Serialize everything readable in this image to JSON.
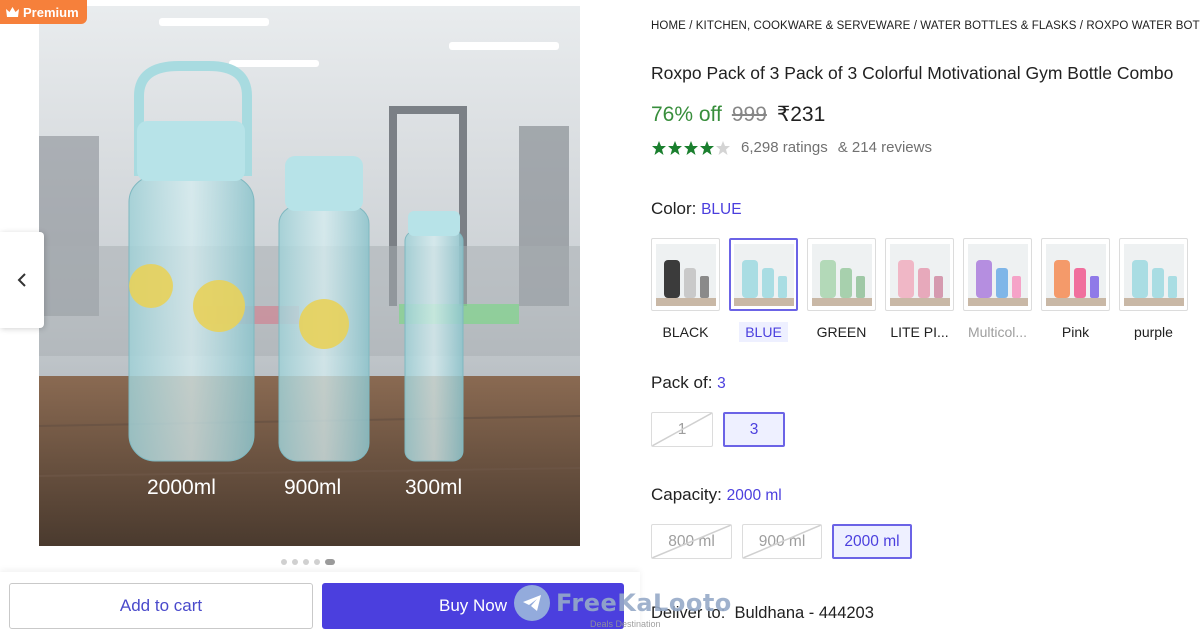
{
  "badge": {
    "label": "Premium"
  },
  "gallery": {
    "labels": [
      "2000ml",
      "900ml",
      "300ml"
    ],
    "dots_total": 5,
    "active_dot": 5
  },
  "actions": {
    "add_to_cart": "Add to cart",
    "buy_now": "Buy Now"
  },
  "watermark": {
    "text": "FreeKaLooto",
    "sub": "Deals Destination"
  },
  "product": {
    "breadcrumb": "HOME / KITCHEN, COOKWARE & SERVEWARE / WATER BOTTLES & FLASKS / ROXPO WATER BOTTLES & FLASKS",
    "title": "Roxpo Pack of 3 Pack of 3 Colorful Motivational Gym Bottle Combo",
    "discount": "76% off",
    "mrp": "999",
    "price": "₹231",
    "rating_stars": 4,
    "ratings": "6,298 ratings",
    "reviews": "& 214 reviews"
  },
  "color": {
    "label": "Color:",
    "value": "BLUE",
    "options": [
      {
        "label": "BLACK",
        "state": "normal"
      },
      {
        "label": "BLUE",
        "state": "selected"
      },
      {
        "label": "GREEN",
        "state": "normal"
      },
      {
        "label": "LITE PI...",
        "state": "normal"
      },
      {
        "label": "Multicol...",
        "state": "disabled"
      },
      {
        "label": "Pink",
        "state": "normal"
      },
      {
        "label": "purple",
        "state": "normal"
      }
    ]
  },
  "pack": {
    "label": "Pack of:",
    "value": "3",
    "options": [
      {
        "label": "1",
        "state": "unavailable"
      },
      {
        "label": "3",
        "state": "selected"
      }
    ]
  },
  "capacity": {
    "label": "Capacity:",
    "value": "2000 ml",
    "options": [
      {
        "label": "800 ml",
        "state": "unavailable"
      },
      {
        "label": "900 ml",
        "state": "unavailable"
      },
      {
        "label": "2000 ml",
        "state": "selected"
      }
    ]
  },
  "delivery": {
    "label": "Deliver to:",
    "location": "Buldhana - 444203"
  },
  "colors": {
    "accent": "#4b3fde",
    "green": "#388e3c",
    "premium": "#f6803b",
    "star": "#1a7f2e"
  }
}
